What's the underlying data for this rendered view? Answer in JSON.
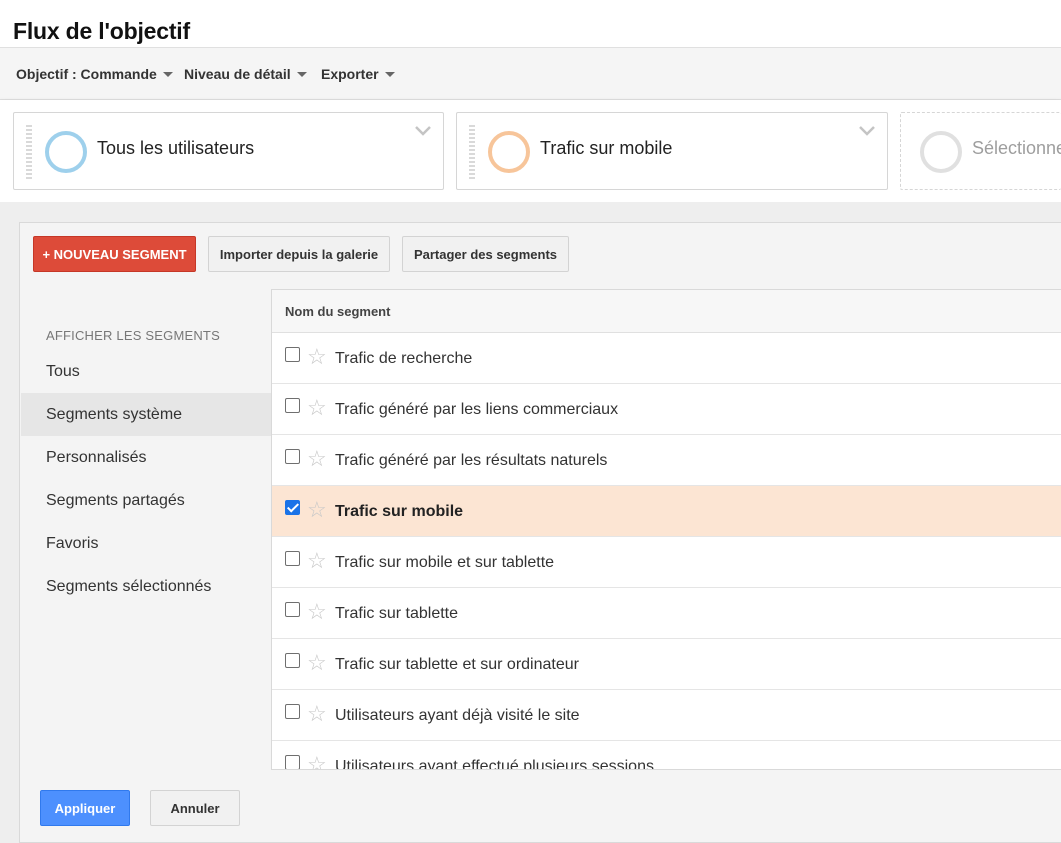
{
  "page_title": "Flux de l'objectif",
  "toolbar": {
    "objective_label": "Objectif : Commande",
    "detail_label": "Niveau de détail",
    "export_label": "Exporter"
  },
  "segment_cards": [
    {
      "name": "Tous les utilisateurs",
      "ring_color": "#9ed0ec"
    },
    {
      "name": "Trafic sur mobile",
      "ring_color": "#f7c59a"
    },
    {
      "name": "Sélectionner",
      "ring_color": "#e0e0e0"
    }
  ],
  "actions": {
    "new_segment": "+ NOUVEAU SEGMENT",
    "import_gallery": "Importer depuis la galerie",
    "share_segments": "Partager des segments"
  },
  "sidebar": {
    "heading": "AFFICHER LES SEGMENTS",
    "items": [
      {
        "label": "Tous"
      },
      {
        "label": "Segments système",
        "active": true
      },
      {
        "label": "Personnalisés"
      },
      {
        "label": "Segments partagés"
      },
      {
        "label": "Favoris"
      },
      {
        "label": "Segments sélectionnés"
      }
    ]
  },
  "table": {
    "column_header": "Nom du segment",
    "rows": [
      {
        "label": "Trafic de recherche",
        "checked": false
      },
      {
        "label": "Trafic généré par les liens commerciaux",
        "checked": false
      },
      {
        "label": "Trafic généré par les résultats naturels",
        "checked": false
      },
      {
        "label": "Trafic sur mobile",
        "checked": true
      },
      {
        "label": "Trafic sur mobile et sur tablette",
        "checked": false
      },
      {
        "label": "Trafic sur tablette",
        "checked": false
      },
      {
        "label": "Trafic sur tablette et sur ordinateur",
        "checked": false
      },
      {
        "label": "Utilisateurs ayant déjà visité le site",
        "checked": false
      },
      {
        "label": "Utilisateurs ayant effectué plusieurs sessions",
        "checked": false
      }
    ]
  },
  "footer": {
    "apply": "Appliquer",
    "cancel": "Annuler"
  },
  "colors": {
    "accent_red": "#dd4b39",
    "accent_blue": "#4d90fe",
    "selected_row": "#fce5d3"
  }
}
